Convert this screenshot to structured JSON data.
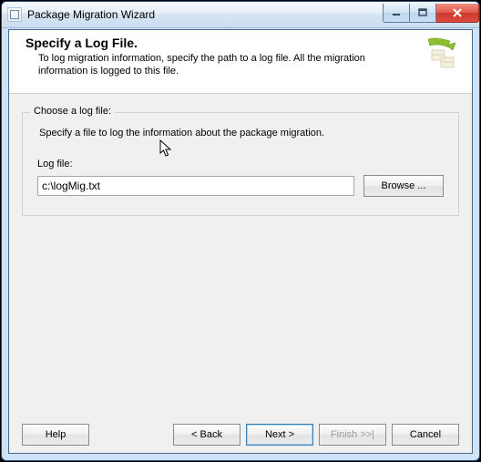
{
  "window": {
    "title": "Package Migration Wizard"
  },
  "header": {
    "heading": "Specify a Log File.",
    "description": "To log migration information, specify the path to a log file. All the migration information is logged to this file."
  },
  "group": {
    "legend": "Choose a log file:",
    "instruction": "Specify a file to log the information about the package migration.",
    "field_label": "Log file:",
    "field_value": "c:\\logMig.txt",
    "browse_label": "Browse ..."
  },
  "footer": {
    "help": "Help",
    "back": "< Back",
    "next": "Next >",
    "finish": "Finish >>|",
    "cancel": "Cancel"
  }
}
